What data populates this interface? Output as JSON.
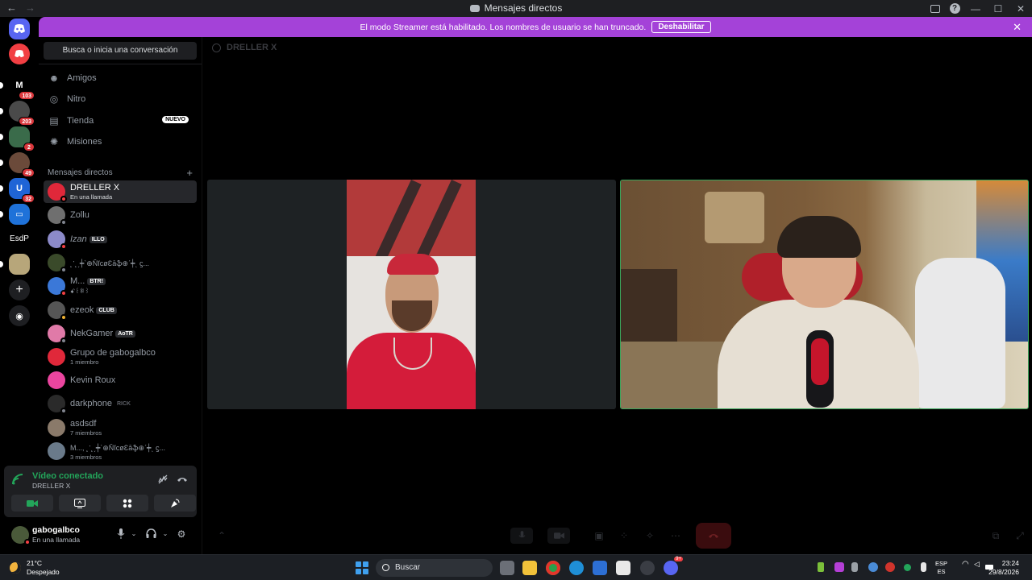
{
  "window": {
    "title": "Mensajes directos",
    "back": "←",
    "forward": "→",
    "help_glyph": "?",
    "controls": [
      "—",
      "☐",
      "✕"
    ]
  },
  "banner": {
    "text": "El modo Streamer está habilitado. Los nombres de usuario se han truncado.",
    "button": "Deshabilitar",
    "close": "✕",
    "color": "#a442d8"
  },
  "servers": [
    {
      "label": "",
      "badge": "",
      "color": "#5865f2",
      "icon": "discord-home-icon"
    },
    {
      "label": "",
      "badge": "",
      "color": "#f23f43",
      "icon": "discord-nitro-icon"
    },
    {
      "label": "M",
      "badge": "103",
      "color": "#000000"
    },
    {
      "label": "",
      "badge": "203",
      "color": "#4a4a4a"
    },
    {
      "label": "",
      "badge": "2",
      "color": "#3a6b4a"
    },
    {
      "label": "",
      "badge": "49",
      "color": "#6b4a3a"
    },
    {
      "label": "U",
      "badge": "32",
      "color": "#1f64d6"
    },
    {
      "label": "",
      "badge": "",
      "color": "#1f72d9"
    },
    {
      "label": "EsdP",
      "badge": "",
      "color": "#000000"
    },
    {
      "label": "",
      "badge": "",
      "color": "#b7a67a"
    }
  ],
  "rail_actions": {
    "add": "+",
    "explore": "◉"
  },
  "sidebar": {
    "search": "Busca o inicia una conversación",
    "nav": [
      {
        "label": "Amigos",
        "icon": "friends-icon",
        "glyph": "☻"
      },
      {
        "label": "Nitro",
        "icon": "nitro-icon",
        "glyph": "◎"
      },
      {
        "label": "Tienda",
        "icon": "shop-icon",
        "glyph": "▤",
        "badge": "NUEVO"
      },
      {
        "label": "Misiones",
        "icon": "quests-icon",
        "glyph": "✺"
      }
    ],
    "dm_header": "Mensajes directos",
    "dm_add": "+",
    "dms": [
      {
        "name": "DRELLER X",
        "sub": "En una llamada",
        "tag": "",
        "color": "#e0283a",
        "status": "#f23f43",
        "active": true
      },
      {
        "name": "Zollu",
        "sub": "",
        "tag": "",
        "color": "#6f6f6f",
        "status": "#80848e"
      },
      {
        "name": "Izan",
        "sub": "",
        "tag": "ILLO",
        "color": "#8c8ac9",
        "status": "#f23f43"
      },
      {
        "name": "˛ॱ˛ˏ┿ˋ⊕ŇĭcøƐāֆ⊕ˊ┿ˎ ϛ...",
        "sub": "",
        "tag": "",
        "color": "#3a4a2a",
        "status": "#80848e"
      },
      {
        "name": "M...",
        "sub": "ꗃ꒰ꉈ꒱",
        "tag": "BTR!",
        "color": "#3b78d8",
        "status": "#f23f43"
      },
      {
        "name": "ezeok",
        "sub": "",
        "tag": "CLUB",
        "color": "#555555",
        "status": "#f0b232"
      },
      {
        "name": "NekGamer",
        "sub": "",
        "tag": "AoTR",
        "color": "#e07aa8",
        "status": "#80848e"
      },
      {
        "name": "Grupo de gabogalbco",
        "sub": "1 miembro",
        "tag": "",
        "color": "#e0283a",
        "status": ""
      },
      {
        "name": "Kevin Roux",
        "sub": "",
        "tag": "",
        "color": "#eb459f",
        "status": ""
      },
      {
        "name": "darkphone",
        "sub": "",
        "tag": "RICK",
        "color": "#2a2a2a",
        "status": "#80848e"
      },
      {
        "name": "asdsdf",
        "sub": "7 miembros",
        "tag": "",
        "color": "#8a7a6a",
        "status": ""
      },
      {
        "name": "M..., ˛ॱ˛ˏ┿ˋ⊕ŇĭcøƐāֆ⊕ˊ┿ˎ ϛ...",
        "sub": "3 miembros",
        "tag": "",
        "color": "#6a7a8a",
        "status": ""
      }
    ]
  },
  "voice_panel": {
    "title": "Vídeo conectado",
    "channel": "DRELLER X",
    "accent": "#23a55a"
  },
  "user_panel": {
    "name": "gabogalbco",
    "status": "En una llamada"
  },
  "call": {
    "title": "DRELLER X",
    "tile_border": "#3ba55c",
    "hangup_color": "#da373c"
  },
  "taskbar": {
    "temp": "21°C",
    "weather": "Despejado",
    "search": "Buscar",
    "lang_1": "ESP",
    "lang_2": "ES",
    "time": "23:24",
    "date": "29/8/2026",
    "discord_badge": "9+"
  }
}
